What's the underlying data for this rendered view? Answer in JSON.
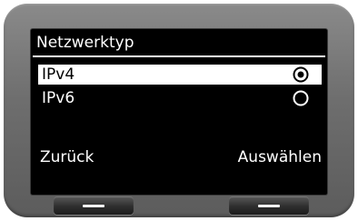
{
  "screen": {
    "title": "Netzwerktyp"
  },
  "options": [
    {
      "label": "IPv4",
      "selected": true
    },
    {
      "label": "IPv6",
      "selected": false
    }
  ],
  "softkeys": {
    "left_label": "Zurück",
    "right_label": "Auswählen"
  },
  "colors": {
    "screen_bg": "#000000",
    "text": "#ffffff",
    "highlight_bg": "#ffffff",
    "highlight_text": "#000000",
    "bezel": "#6e6e6e"
  },
  "icons": {
    "radio_selected": "radio-selected-icon",
    "radio_unselected": "radio-unselected-icon",
    "softkey_bar": "minus-icon"
  }
}
